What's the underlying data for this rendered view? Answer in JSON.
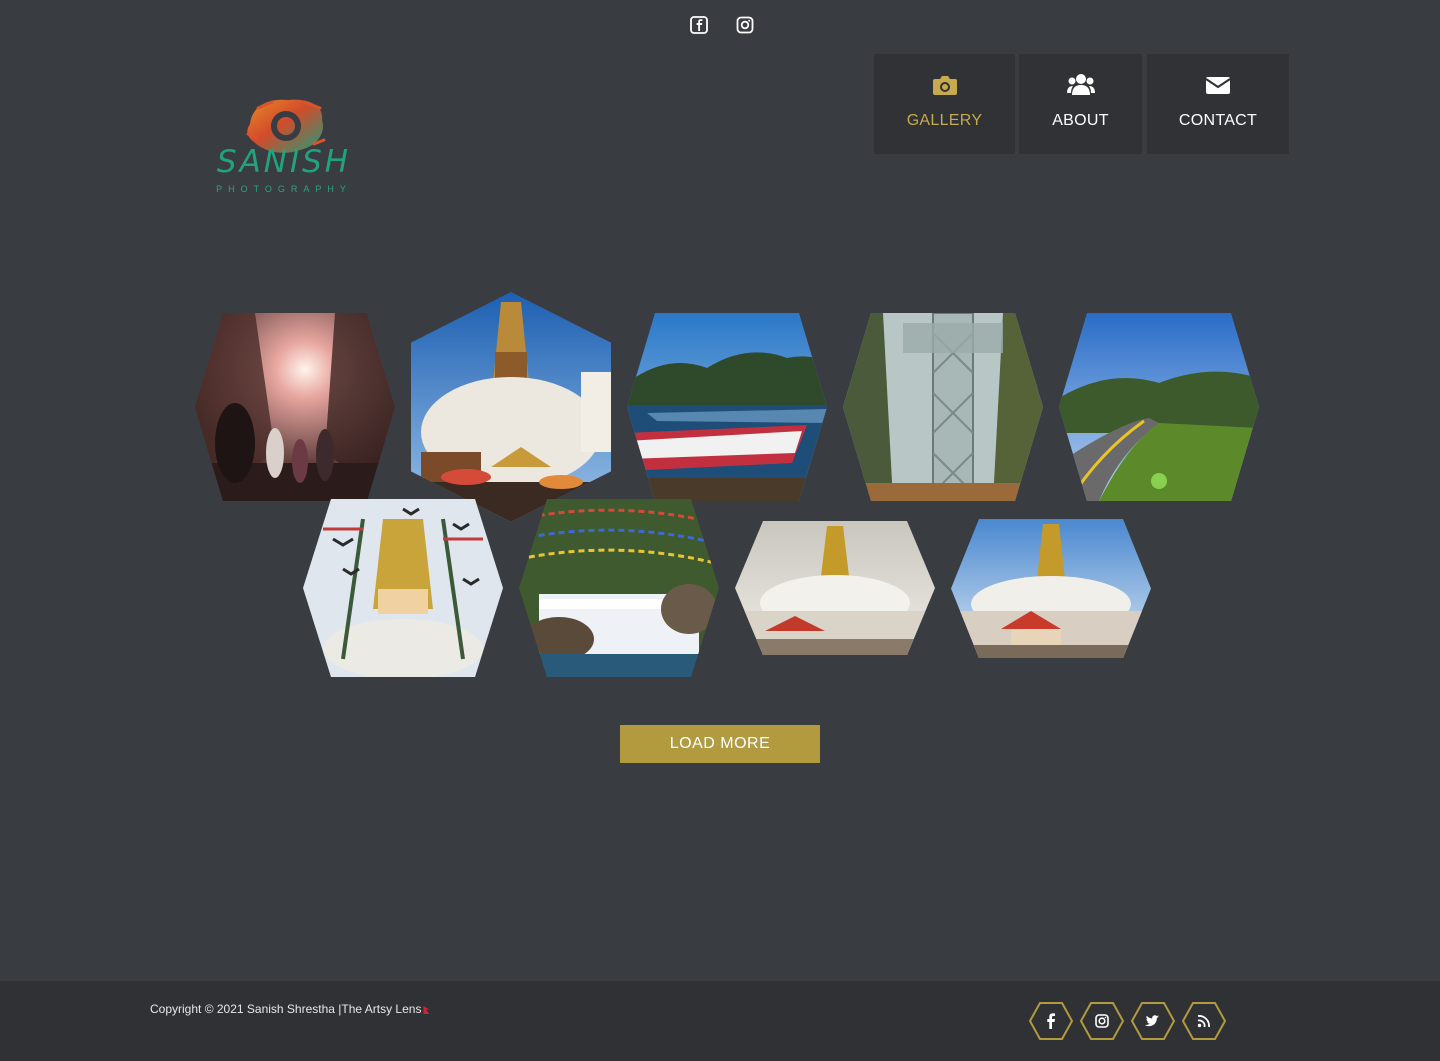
{
  "header": {
    "top_social": [
      {
        "icon": "facebook-square-icon"
      },
      {
        "icon": "instagram-icon"
      }
    ],
    "logo": {
      "word": "SANISH",
      "sub": "PHOTOGRAPHY",
      "colors": {
        "brush_orange": "#e6702a",
        "brush_red": "#c63a2a",
        "brush_teal": "#1f9e7a"
      }
    }
  },
  "nav": {
    "items": [
      {
        "label": "GALLERY",
        "icon": "camera-icon",
        "active": true
      },
      {
        "label": "ABOUT",
        "icon": "users-icon",
        "active": false
      },
      {
        "label": "CONTACT",
        "icon": "envelope-icon",
        "active": false
      }
    ],
    "accent_color": "#c7aa4e"
  },
  "gallery": {
    "photos": [
      {
        "name": "photo-sunlit-street"
      },
      {
        "name": "photo-swayambhu-stupa"
      },
      {
        "name": "photo-lake-boat"
      },
      {
        "name": "photo-cable-car"
      },
      {
        "name": "photo-mountain-road"
      },
      {
        "name": "photo-stupa-pigeons"
      },
      {
        "name": "photo-waterfall-flags"
      },
      {
        "name": "photo-boudha-stupa-1"
      },
      {
        "name": "photo-boudha-stupa-2"
      }
    ],
    "load_more_label": "LOAD MORE"
  },
  "footer": {
    "copyright": "Copyright © 2021 Sanish Shrestha |The Artsy Lens",
    "social": [
      {
        "icon": "facebook-icon"
      },
      {
        "icon": "instagram-icon"
      },
      {
        "icon": "twitter-icon"
      },
      {
        "icon": "rss-icon"
      }
    ],
    "hex_border_color": "#b29a3f"
  },
  "colors": {
    "page_bg": "#393c41",
    "nav_bg": "#303236",
    "footer_bg": "#2f3135",
    "button_bg": "#b29a3f"
  }
}
